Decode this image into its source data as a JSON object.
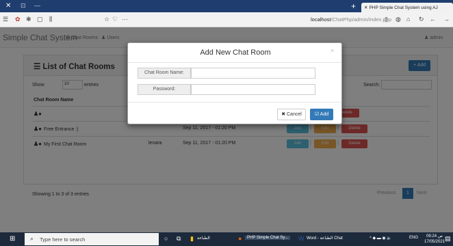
{
  "browser": {
    "tab_title": "PHP Simple Chat System using AJ",
    "url_host": "localhost",
    "url_path": "/ChatPhp/admin/index.php"
  },
  "app": {
    "brand": "Simple Chat System",
    "nav": [
      {
        "label": "Chat Rooms",
        "icon": "list-icon"
      },
      {
        "label": "Users",
        "icon": "user-icon"
      }
    ],
    "user": "admin"
  },
  "panel": {
    "title": "List of Chat Rooms",
    "add_label": "+ Add",
    "show_label": "Show",
    "page_length": "10",
    "entries_label": "entries",
    "search_label": "Search:",
    "column_header": "Chat Room Name",
    "rows": [
      {
        "name": "",
        "creator": "",
        "date": "",
        "join": "Join",
        "edit": "Edit",
        "delete": "Delete"
      },
      {
        "name": "Free Entrance :)",
        "creator": "",
        "date": "Sep 11, 2017 - 01:20 PM",
        "join": "Join",
        "edit": "Edit",
        "delete": "Delete"
      },
      {
        "name": "My First Chat Room",
        "creator": "lenara",
        "date": "Sep 11, 2017 - 01:20 PM",
        "join": "Join",
        "edit": "Edit",
        "delete": "Delete"
      }
    ],
    "info": "Showing 1 to 3 of 3 entries",
    "pagination": {
      "prev": "Previous",
      "current": "1",
      "next": "Next"
    }
  },
  "modal": {
    "title": "Add New Chat Room",
    "close": "×",
    "fields": [
      {
        "label": "Chat Room Name:",
        "value": ""
      },
      {
        "label": "Password:",
        "value": ""
      }
    ],
    "cancel_label": "✖ Cancel",
    "add_label": "☑ Add"
  },
  "taskbar": {
    "search_placeholder": "Type here to search",
    "apps": [
      {
        "label": "الطباعة"
      },
      {
        "label": "PHP Simple Chat Sy..."
      },
      {
        "label": "Word - الطباعة Chat"
      }
    ],
    "language": "ENG",
    "time": "09:24 ص",
    "date": "17/05/2021"
  },
  "colors": {
    "primary": "#337ab7",
    "info": "#5bc0de",
    "warning": "#f0ad4e",
    "danger": "#d9534f",
    "titlebar": "#1f3d6e",
    "taskbar": "#1d2a3c"
  }
}
